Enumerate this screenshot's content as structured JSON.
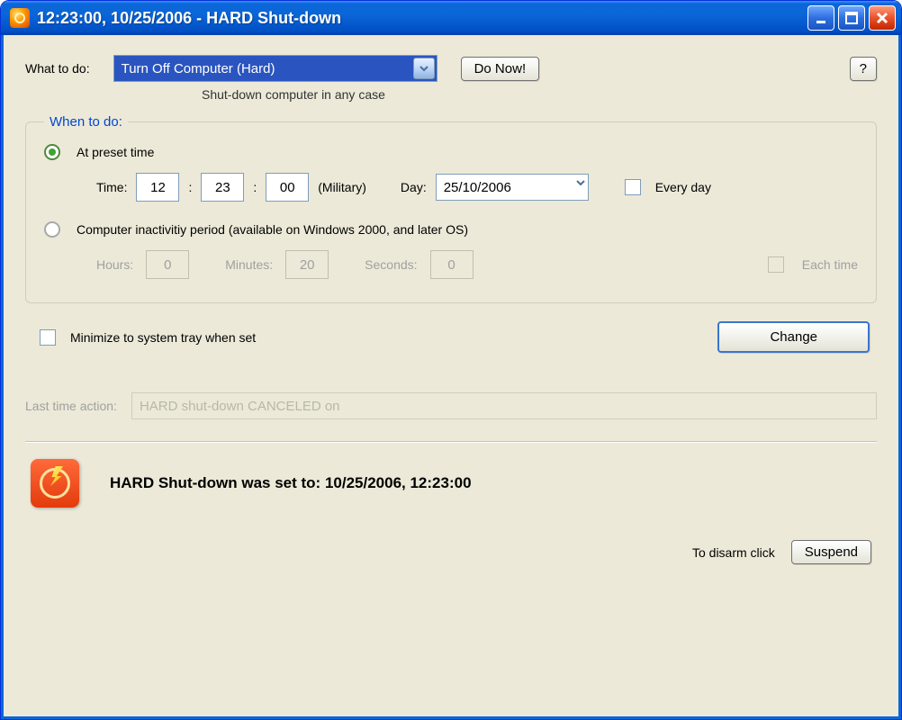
{
  "title": "12:23:00, 10/25/2006 - HARD Shut-down",
  "what_to_do": {
    "label": "What to do:",
    "selected": "Turn Off Computer (Hard)",
    "description": "Shut-down computer in any case",
    "do_now": "Do Now!",
    "help": "?"
  },
  "when": {
    "legend": "When to do:",
    "preset": {
      "radio_label": "At preset time",
      "time_label": "Time:",
      "hh": "12",
      "mm": "23",
      "ss": "00",
      "military": "(Military)",
      "day_label": "Day:",
      "day_value": "25/10/2006",
      "every_day": "Every day"
    },
    "inactivity": {
      "radio_label": "Computer inactivitiy period (available on Windows 2000, and later OS)",
      "hours_label": "Hours:",
      "hours_value": "0",
      "minutes_label": "Minutes:",
      "minutes_value": "20",
      "seconds_label": "Seconds:",
      "seconds_value": "0",
      "each_time": "Each time"
    }
  },
  "minimize_tray": "Minimize to system tray when set",
  "change_btn": "Change",
  "last_action": {
    "label": "Last time action:",
    "value": "HARD shut-down CANCELED on"
  },
  "status": "HARD Shut-down was set to: 10/25/2006, 12:23:00",
  "disarm": {
    "label": "To disarm click",
    "button": "Suspend"
  }
}
